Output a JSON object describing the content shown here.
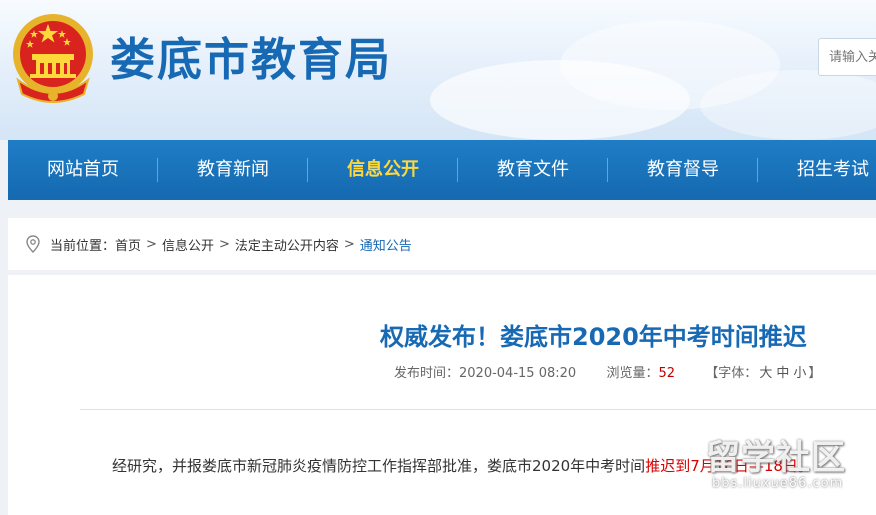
{
  "header": {
    "site_title": "娄底市教育局",
    "search_placeholder": "请输入关键字",
    "emblem_icon": "national-emblem"
  },
  "nav": {
    "items": [
      {
        "label": "网站首页",
        "active": false
      },
      {
        "label": "教育新闻",
        "active": false
      },
      {
        "label": "信息公开",
        "active": true
      },
      {
        "label": "教育文件",
        "active": false
      },
      {
        "label": "教育督导",
        "active": false
      },
      {
        "label": "招生考试",
        "active": false
      }
    ]
  },
  "breadcrumb": {
    "prefix": "当前位置：",
    "icon": "location-pin-icon",
    "items": [
      "首页",
      "信息公开",
      "法定主动公开内容",
      "通知公告"
    ],
    "separator": ">"
  },
  "article": {
    "title": "权威发布！娄底市2020年中考时间推迟",
    "publish_label": "发布时间：",
    "publish_time": "2020-04-15 08:20",
    "views_label": "浏览量：",
    "views": "52",
    "font_label": "【字体：",
    "font_sizes": [
      "大",
      "中",
      "小"
    ],
    "font_close": "】",
    "body_prefix": "经研究，并报娄底市新冠肺炎疫情防控工作指挥部批准，娄底市2020年中考时间",
    "body_highlight": "推迟到7月16日—18日",
    "body_suffix": "。"
  },
  "watermark": {
    "big": "留学社区",
    "small": "bbs.liuxue86.com"
  },
  "colors": {
    "brand_blue": "#1769b4",
    "nav_active": "#ffd83c",
    "highlight_red": "#d80000"
  }
}
